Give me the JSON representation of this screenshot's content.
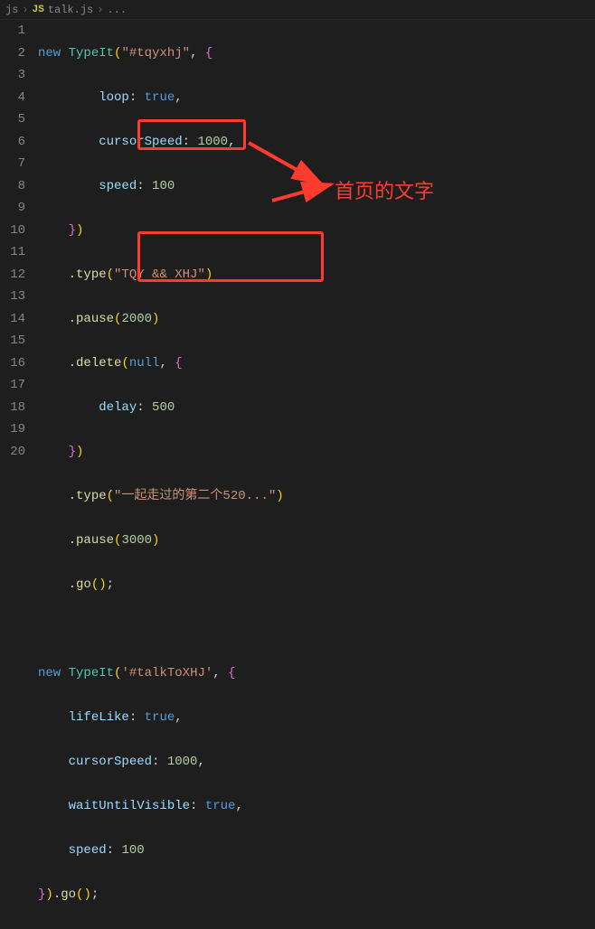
{
  "breadcrumb": {
    "ext_prefix": "js",
    "lang_badge": "JS",
    "filename": "talk.js",
    "trailing": "..."
  },
  "gutter": {
    "lines": [
      "1",
      "2",
      "3",
      "4",
      "5",
      "6",
      "7",
      "8",
      "9",
      "10",
      "11",
      "12",
      "13",
      "14",
      "15",
      "16",
      "17",
      "18",
      "19",
      "20"
    ]
  },
  "code": {
    "l1": {
      "kw": "new",
      "cls": "TypeIt",
      "open": "(",
      "str": "\"#tqyxhj\"",
      "comma": ", ",
      "brace": "{"
    },
    "l2": {
      "prop": "loop",
      "colon": ": ",
      "val": "true",
      "comma": ","
    },
    "l3": {
      "prop": "cursorSpeed",
      "colon": ": ",
      "val": "1000",
      "comma": ","
    },
    "l4": {
      "prop": "speed",
      "colon": ": ",
      "val": "100"
    },
    "l5": {
      "close": "})"
    },
    "l6": {
      "dot": ".",
      "fn": "type",
      "open": "(",
      "str": "\"TQY && XHJ\"",
      "close": ")"
    },
    "l7": {
      "dot": ".",
      "fn": "pause",
      "open": "(",
      "num": "2000",
      "close": ")"
    },
    "l8": {
      "dot": ".",
      "fn": "delete",
      "open": "(",
      "arg": "null",
      "comma": ", ",
      "brace": "{"
    },
    "l9": {
      "prop": "delay",
      "colon": ": ",
      "val": "500"
    },
    "l10": {
      "close": "})"
    },
    "l11": {
      "dot": ".",
      "fn": "type",
      "open": "(",
      "str": "\"一起走过的第二个520...\"",
      "close": ")"
    },
    "l12": {
      "dot": ".",
      "fn": "pause",
      "open": "(",
      "num": "3000",
      "close": ")"
    },
    "l13": {
      "dot": ".",
      "fn": "go",
      "open": "(",
      "close": ");"
    },
    "l15": {
      "kw": "new",
      "cls": "TypeIt",
      "open": "(",
      "str": "'#talkToXHJ'",
      "comma": ", ",
      "brace": "{"
    },
    "l16": {
      "prop": "lifeLike",
      "colon": ": ",
      "val": "true",
      "comma": ","
    },
    "l17": {
      "prop": "cursorSpeed",
      "colon": ": ",
      "val": "1000",
      "comma": ","
    },
    "l18": {
      "prop": "waitUntilVisible",
      "colon": ": ",
      "val": "true",
      "comma": ","
    },
    "l19": {
      "prop": "speed",
      "colon": ": ",
      "val": "100"
    },
    "l20": {
      "close": "}).",
      "fn": "go",
      "open2": "(",
      "close2": ");"
    }
  },
  "annotation": {
    "label": "首页的文字"
  }
}
